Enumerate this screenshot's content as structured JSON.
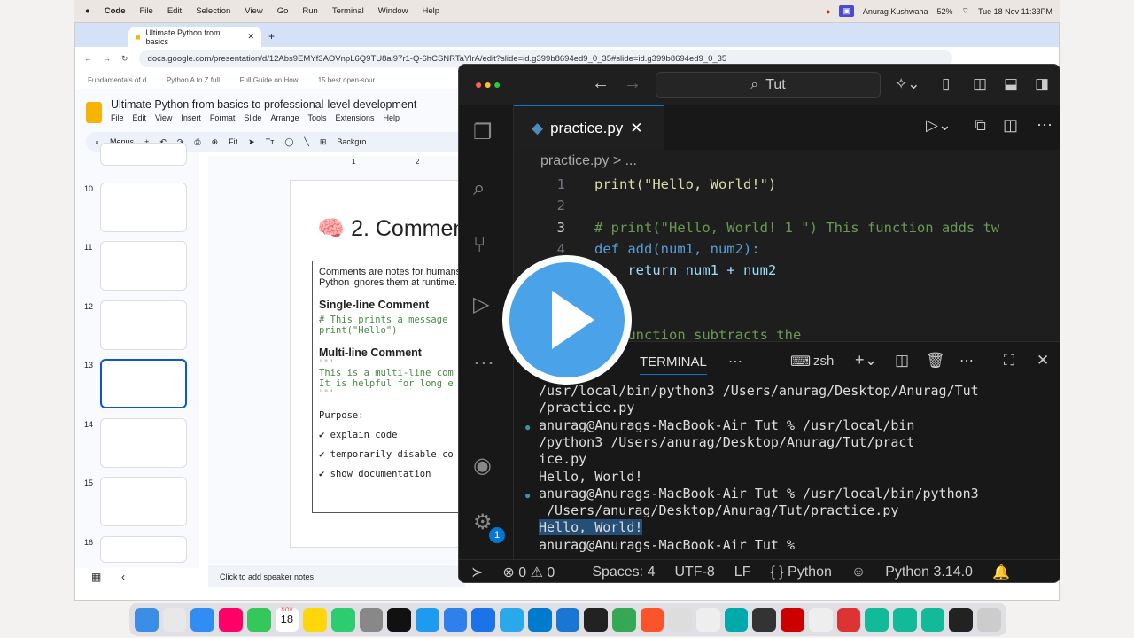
{
  "menubar": {
    "app": "Code",
    "items": [
      "File",
      "Edit",
      "Selection",
      "View",
      "Go",
      "Run",
      "Terminal",
      "Window",
      "Help"
    ],
    "user": "Anurag Kushwaha",
    "battery": "52%",
    "datetime": "Tue 18 Nov 11:33PM"
  },
  "browser": {
    "tab_title": "Ultimate Python from basics",
    "url": "docs.google.com/presentation/d/12Abs9EMYf3AOVnpL6Q9TU8ai97r1-Q-6hCSNRTaYlrA/edit?slide=id.g399b8694ed9_0_35#slide=id.g399b8694ed9_0_35",
    "bookmarks": [
      "Fundamentals of d...",
      "Python A to Z full...",
      "Full Guide on How...",
      "15 best open-sour..."
    ]
  },
  "slides": {
    "title": "Ultimate Python from basics to professional-level development",
    "menu": [
      "File",
      "Edit",
      "View",
      "Insert",
      "Format",
      "Slide",
      "Arrange",
      "Tools",
      "Extensions",
      "Help"
    ],
    "toolbar": {
      "menus": "Menus",
      "zoom": "Fit",
      "background": "Backgro"
    },
    "thumbs": [
      "10",
      "11",
      "12",
      "13",
      "14",
      "15",
      "16"
    ],
    "selected": "13",
    "slide": {
      "heading": "🧠 2. Commen",
      "intro": [
        "Comments are notes for humans",
        "Python ignores them at runtime."
      ],
      "h1": "Single-line Comment",
      "code1": [
        "# This prints a message",
        "print(\"Hello\")"
      ],
      "h2": "Multi-line Comment",
      "code2": [
        "\"\"\"",
        "This is a multi-line com",
        "It is helpful for long e",
        "\"\"\""
      ],
      "purpose": "Purpose:",
      "bullets": [
        "✔ explain code",
        "✔ temporarily disable co",
        "✔ show documentation"
      ]
    },
    "notes": "Click to add speaker notes",
    "ruler": [
      "1",
      "2"
    ]
  },
  "vscode": {
    "search": "Tut",
    "tab": "practice.py",
    "breadcrumb": "practice.py > ...",
    "lines": [
      {
        "n": "1",
        "t": "print(\"Hello, World!\")"
      },
      {
        "n": "2",
        "t": ""
      },
      {
        "n": "3",
        "t": "# print(\"Hello, World! 1 \") This function adds tw"
      },
      {
        "n": "4",
        "t": "def add(num1, num2):"
      },
      {
        "n": "",
        "t": "    return num1 + num2"
      },
      {
        "n": "",
        "t": ""
      },
      {
        "n": "",
        "t": ""
      },
      {
        "n": "",
        "t": "   function subtracts the"
      }
    ],
    "panel": {
      "tab": "TERMINAL",
      "shell": "zsh",
      "badge": "1"
    },
    "terminal": [
      "/usr/local/bin/python3 /Users/anurag/Desktop/Anurag/Tut",
      "/practice.py",
      "anurag@Anurags-MacBook-Air Tut % /usr/local/bin",
      "/python3 /Users/anurag/Desktop/Anurag/Tut/pract",
      "ice.py",
      "Hello, World!",
      "anurag@Anurags-MacBook-Air Tut % /usr/local/bin/python3",
      " /Users/anurag/Desktop/Anurag/Tut/practice.py",
      "Hello, World!",
      "anurag@Anurags-MacBook-Air Tut % "
    ],
    "status": {
      "errors": "0",
      "warnings": "0",
      "spaces": "Spaces: 4",
      "encoding": "UTF-8",
      "eol": "LF",
      "lang": "{ } Python",
      "interpreter": "Python 3.14.0"
    }
  },
  "dock": {
    "calendar_month": "NOV",
    "calendar_day": "18"
  },
  "colors": {
    "accent": "#0078d4",
    "play": "#4aa3e8",
    "selected_slide": "#0b57d0"
  }
}
